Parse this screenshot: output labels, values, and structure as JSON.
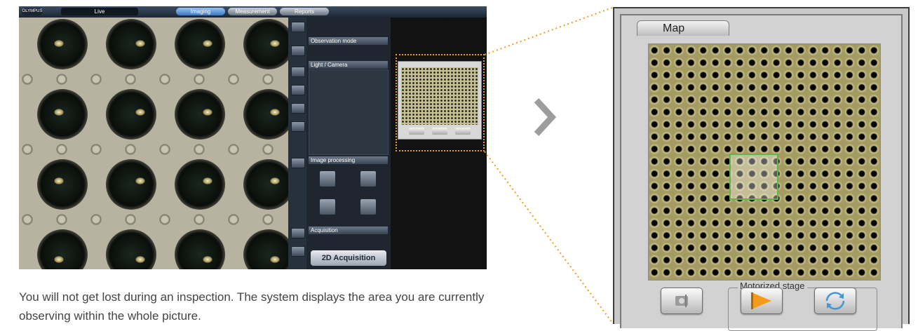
{
  "app": {
    "mode_label": "Live",
    "tabs": [
      "Imaging",
      "Measurement",
      "Reports"
    ]
  },
  "left_panel": {
    "observation_mode": "Observation mode",
    "light_camera": "Light / Camera",
    "image_processing": "Image processing",
    "acquisition": "Acquisition",
    "acquire_button": "2D Acquisition"
  },
  "description": "You will not get lost during an inspection. The system displays the area you are currently observing within the whole picture.",
  "map_panel": {
    "tab_label": "Map",
    "stage_group_label": "Motorized stage",
    "buttons": [
      "camera-button",
      "play-button",
      "refresh-button"
    ]
  },
  "colors": {
    "accent_orange": "#f39a1e",
    "view_box_green": "#63b34b",
    "chevron_gray": "#9d9d9d"
  }
}
